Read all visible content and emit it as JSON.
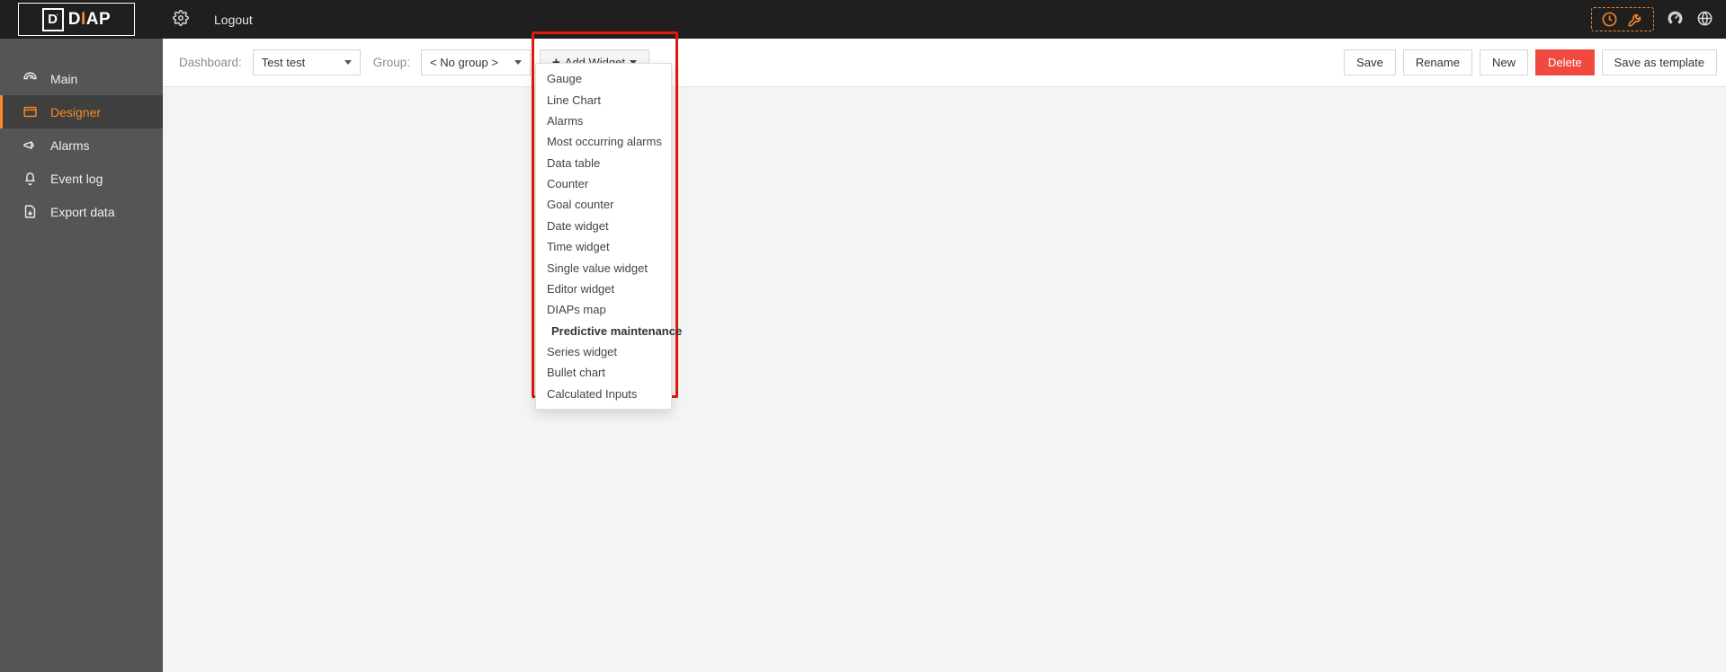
{
  "header": {
    "logout": "Logout"
  },
  "sidebar": {
    "items": [
      {
        "label": "Main"
      },
      {
        "label": "Designer"
      },
      {
        "label": "Alarms"
      },
      {
        "label": "Event log"
      },
      {
        "label": "Export data"
      }
    ]
  },
  "toolbar": {
    "dashboard_label": "Dashboard:",
    "dashboard_value": "Test test",
    "group_label": "Group:",
    "group_value": "< No group >",
    "add_widget": "Add Widget",
    "save": "Save",
    "rename": "Rename",
    "new": "New",
    "delete": "Delete",
    "save_template": "Save as template"
  },
  "widget_menu": [
    {
      "label": "Gauge"
    },
    {
      "label": "Line Chart"
    },
    {
      "label": "Alarms"
    },
    {
      "label": "Most occurring alarms"
    },
    {
      "label": "Data table"
    },
    {
      "label": "Counter"
    },
    {
      "label": "Goal counter"
    },
    {
      "label": "Date widget"
    },
    {
      "label": "Time widget"
    },
    {
      "label": "Single value widget"
    },
    {
      "label": "Editor widget"
    },
    {
      "label": "DIAPs map"
    },
    {
      "label": "Predictive maintenance",
      "emph": true
    },
    {
      "label": "Series widget"
    },
    {
      "label": "Bullet chart"
    },
    {
      "label": "Calculated Inputs"
    }
  ]
}
